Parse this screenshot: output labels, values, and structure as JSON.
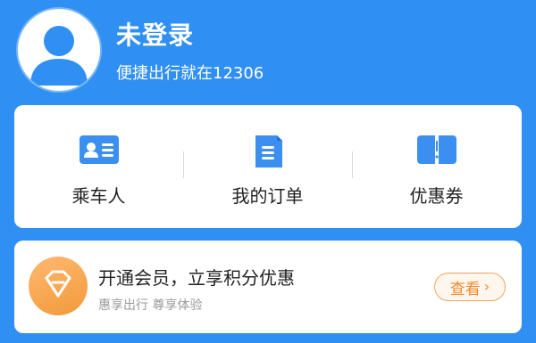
{
  "user": {
    "title": "未登录",
    "subtitle": "便捷出行就在12306"
  },
  "menu": [
    {
      "label": "乘车人",
      "icon": "id-card-icon"
    },
    {
      "label": "我的订单",
      "icon": "order-document-icon"
    },
    {
      "label": "优惠券",
      "icon": "coupon-icon"
    }
  ],
  "vip": {
    "title": "开通会员，立享积分优惠",
    "subtitle": "惠享出行 尊享体验",
    "button_label": "查看",
    "badge_icon": "diamond-icon"
  },
  "colors": {
    "brand_blue": "#2f8ff3",
    "accent_orange": "#f0892a"
  }
}
